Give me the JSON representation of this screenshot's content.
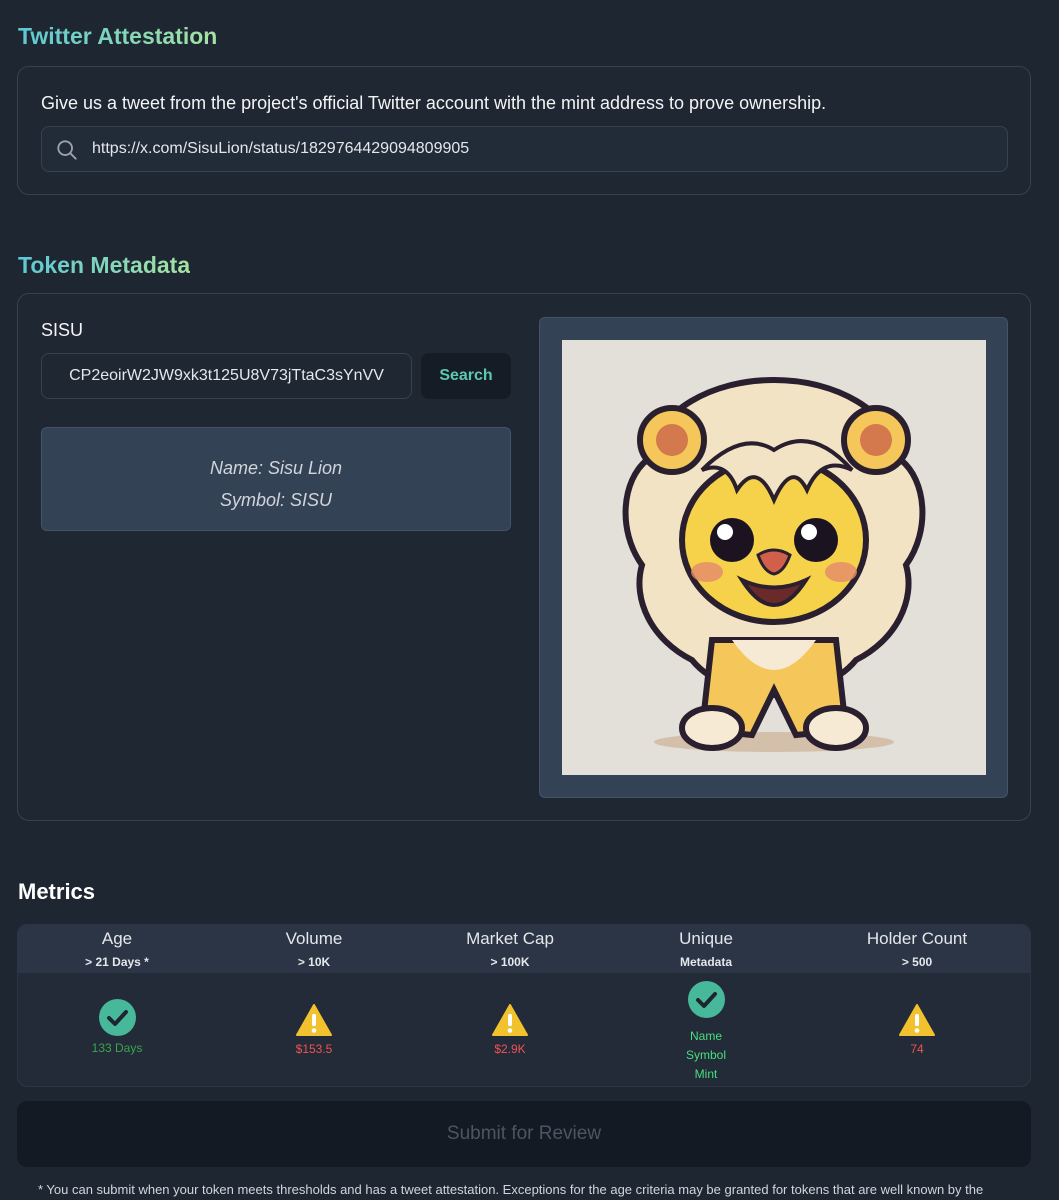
{
  "twitter": {
    "title": "Twitter Attestation",
    "description": "Give us a tweet from the project's official Twitter account with the mint address to prove ownership.",
    "url_value": "https://x.com/SisuLion/status/1829764429094809905"
  },
  "token": {
    "title": "Token Metadata",
    "symbol_label": "SISU",
    "mint_value": "CP2eoirW2JW9xk3t125U8V73jTtaC3sYnVV",
    "search_label": "Search",
    "name_line": "Name: Sisu Lion",
    "symbol_line": "Symbol: SISU"
  },
  "metrics": {
    "title": "Metrics",
    "columns": [
      {
        "label": "Age",
        "threshold": "> 21 Days *",
        "status": "pass",
        "value": "133 Days"
      },
      {
        "label": "Volume",
        "threshold": "> 10K",
        "status": "warn",
        "value": "$153.5"
      },
      {
        "label": "Market Cap",
        "threshold": "> 100K",
        "status": "warn",
        "value": "$2.9K"
      },
      {
        "label": "Unique",
        "threshold": "Metadata",
        "status": "pass",
        "items": [
          "Name",
          "Symbol",
          "Mint"
        ]
      },
      {
        "label": "Holder Count",
        "threshold": "> 500",
        "status": "warn",
        "value": "74"
      }
    ]
  },
  "submit": {
    "label": "Submit for Review"
  },
  "footnote": "* You can submit when your token meets thresholds and has a tweet attestation. Exceptions for the age criteria may be granted for tokens that are well known by the",
  "colors": {
    "pass": "#48b89a",
    "warn": "#f2c12e",
    "accent": "#5cc8b0"
  },
  "icons": {
    "search": "search-icon",
    "pass": "check-circle-icon",
    "warn": "warning-triangle-icon"
  }
}
